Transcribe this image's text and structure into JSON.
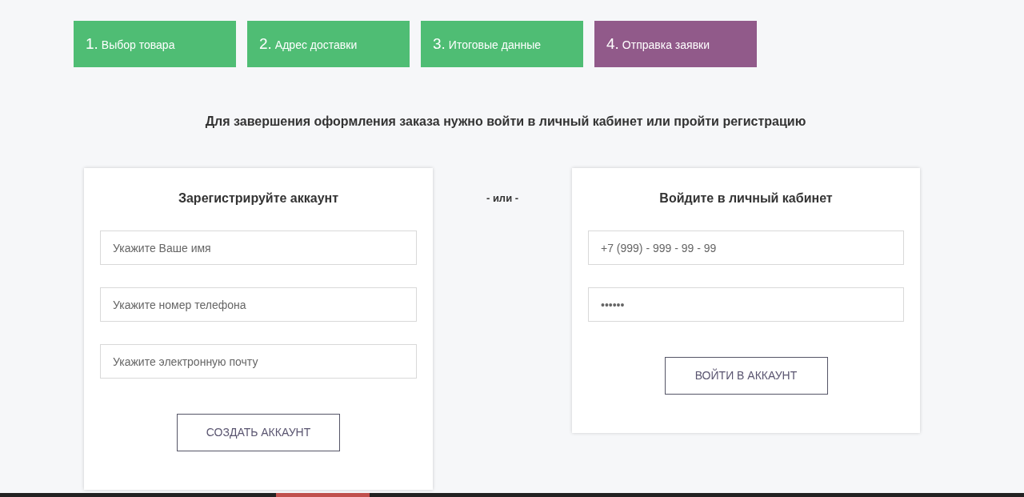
{
  "steps": [
    {
      "number": "1.",
      "label": "Выбор товара",
      "selected": false
    },
    {
      "number": "2.",
      "label": "Адрес доставки",
      "selected": false
    },
    {
      "number": "3.",
      "label": "Итоговые данные",
      "selected": false
    },
    {
      "number": "4.",
      "label": "Отправка заявки",
      "selected": true
    }
  ],
  "notice": "Для завершения оформления заказа нужно войти в личный кабинет или пройти регистрацию",
  "register": {
    "title": "Зарегистрируйте аккаунт",
    "fields": [
      {
        "placeholder": "Укажите Ваше имя"
      },
      {
        "placeholder": "Укажите номер телефона"
      },
      {
        "placeholder": "Укажите электронную почту"
      }
    ],
    "button": "СОЗДАТЬ АККАУНТ"
  },
  "separator": "- или -",
  "login": {
    "title": "Войдите в личный кабинет",
    "fields": [
      {
        "placeholder": "+7 (999) - 999 - 99 - 99"
      },
      {
        "placeholder": "••••••"
      }
    ],
    "button": "ВОЙТИ В АККАУНТ"
  }
}
